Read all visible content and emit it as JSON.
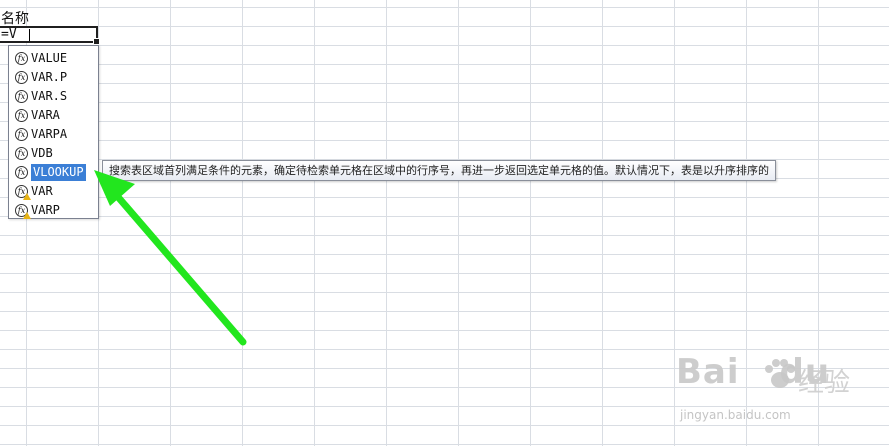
{
  "sheet": {
    "cell_a1": "名称",
    "formula_input": "=V"
  },
  "autocomplete": {
    "items": [
      {
        "label": "VALUE",
        "icon": "function-icon",
        "warning": false
      },
      {
        "label": "VAR.P",
        "icon": "function-icon",
        "warning": false
      },
      {
        "label": "VAR.S",
        "icon": "function-icon",
        "warning": false
      },
      {
        "label": "VARA",
        "icon": "function-icon",
        "warning": false
      },
      {
        "label": "VARPA",
        "icon": "function-icon",
        "warning": false
      },
      {
        "label": "VDB",
        "icon": "function-icon",
        "warning": false
      },
      {
        "label": "VLOOKUP",
        "icon": "function-icon",
        "warning": false,
        "selected": true
      },
      {
        "label": "VAR",
        "icon": "function-warning-icon",
        "warning": true
      },
      {
        "label": "VARP",
        "icon": "function-warning-icon",
        "warning": true
      }
    ],
    "icon_glyph": "fx"
  },
  "tooltip": {
    "text": "搜索表区域首列满足条件的元素，确定待检索单元格在区域中的行序号，再进一步返回选定单元格的值。默认情况下，表是以升序排序的"
  },
  "annotation": {
    "arrow_color": "#22e61e"
  },
  "watermark": {
    "brand_a": "Bai",
    "brand_b": "du",
    "brand_cn": "经验",
    "url": "jingyan.baidu.com"
  },
  "colors": {
    "selection": "#3b7fd6",
    "gridline": "#d9dde3"
  }
}
